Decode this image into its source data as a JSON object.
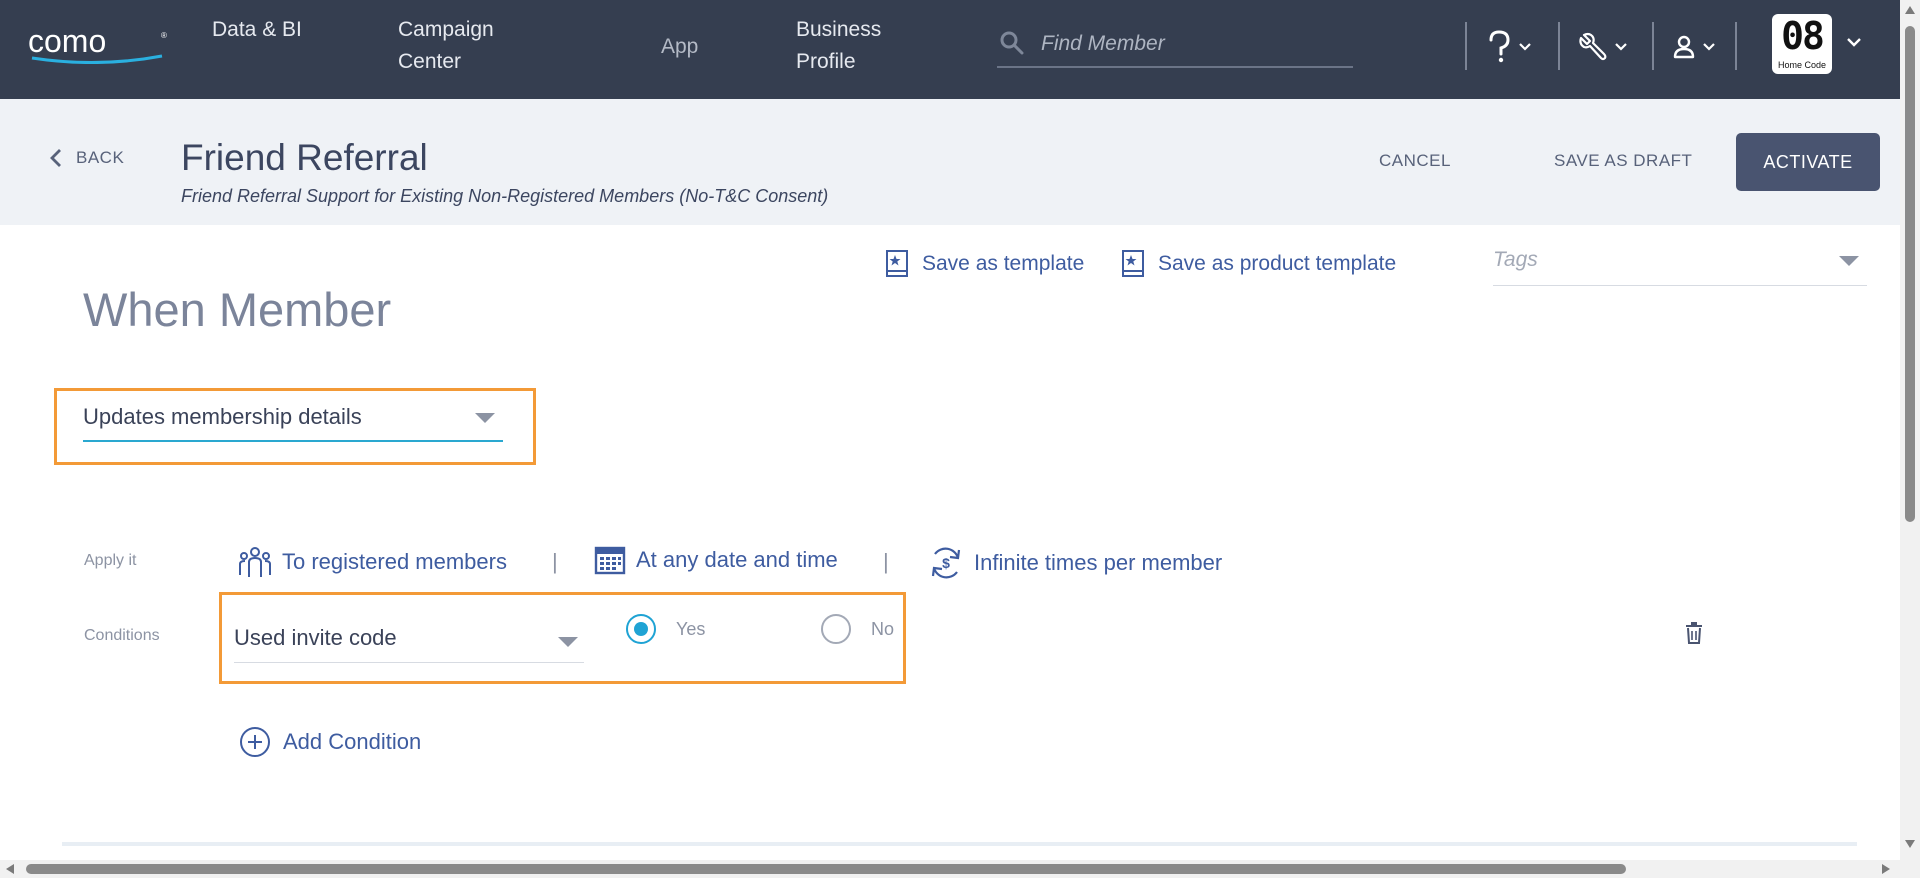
{
  "nav": {
    "logo_text": "como",
    "items": [
      "Data & BI",
      "Campaign Center",
      "App",
      "Business Profile"
    ],
    "search_placeholder": "Find Member",
    "icons": [
      "search-icon",
      "help-icon",
      "tools-icon",
      "user-icon"
    ],
    "brand_logo_number": "08",
    "brand_logo_caption": "Home Code"
  },
  "header": {
    "back_label": "BACK",
    "title": "Friend Referral",
    "subtitle": "Friend Referral Support for Existing Non-Registered Members (No-T&C Consent)",
    "cancel_label": "CANCEL",
    "save_draft_label": "SAVE AS DRAFT",
    "activate_label": "ACTIVATE"
  },
  "templates": {
    "save_template_label": "Save as template",
    "save_product_template_label": "Save as product template",
    "tags_placeholder": "Tags"
  },
  "when": {
    "heading": "When Member",
    "trigger_value": "Updates membership details"
  },
  "apply": {
    "label": "Apply it",
    "members": "To registered members",
    "date": "At any date and time",
    "frequency": "Infinite times per member",
    "separator": "|"
  },
  "conditions": {
    "label": "Conditions",
    "field_value": "Used invite code",
    "yes_label": "Yes",
    "no_label": "No",
    "selected": "Yes",
    "add_label": "Add Condition"
  },
  "colors": {
    "navbar": "#353e50",
    "accent_blue": "#3e5ca0",
    "highlight_orange": "#f39a37",
    "radio_active": "#1fa3d4",
    "activate_button": "#495470"
  }
}
